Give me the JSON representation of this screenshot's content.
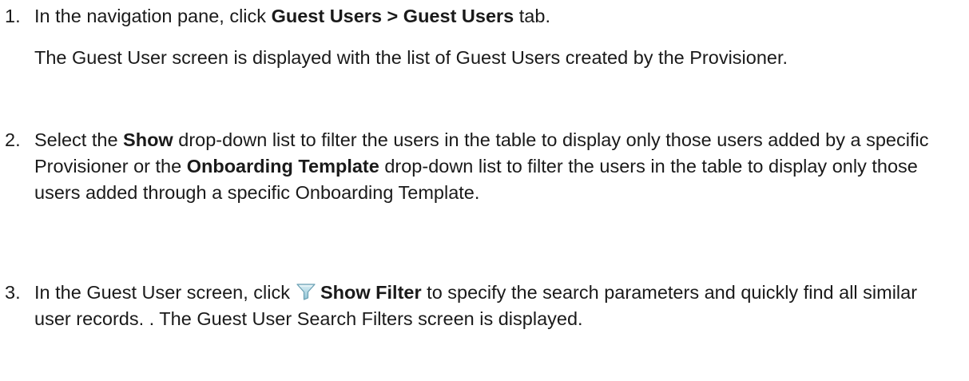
{
  "steps": [
    {
      "number": "1.",
      "text_before": "In the navigation pane, click ",
      "bold": "Guest Users > Guest Users",
      "text_after": " tab.",
      "note": "The Guest User screen is displayed with the list of Guest Users created by the Provisioner."
    },
    {
      "number": "2.",
      "text_1": "Select the ",
      "bold_1": "Show",
      "text_2": " drop-down list to filter the users in the table to display only those users added by a specific Provisioner or the ",
      "bold_2": "Onboarding Template",
      "text_3": " drop-down list to filter the users in the table to display only those users added through a specific Onboarding Template."
    },
    {
      "number": "3.",
      "text_before": "In the Guest User screen, click",
      "icon": "filter-icon",
      "bold": "Show Filter",
      "text_after": " to specify the search parameters and quickly find all similar user records. . The Guest User Search Filters screen is displayed."
    }
  ]
}
